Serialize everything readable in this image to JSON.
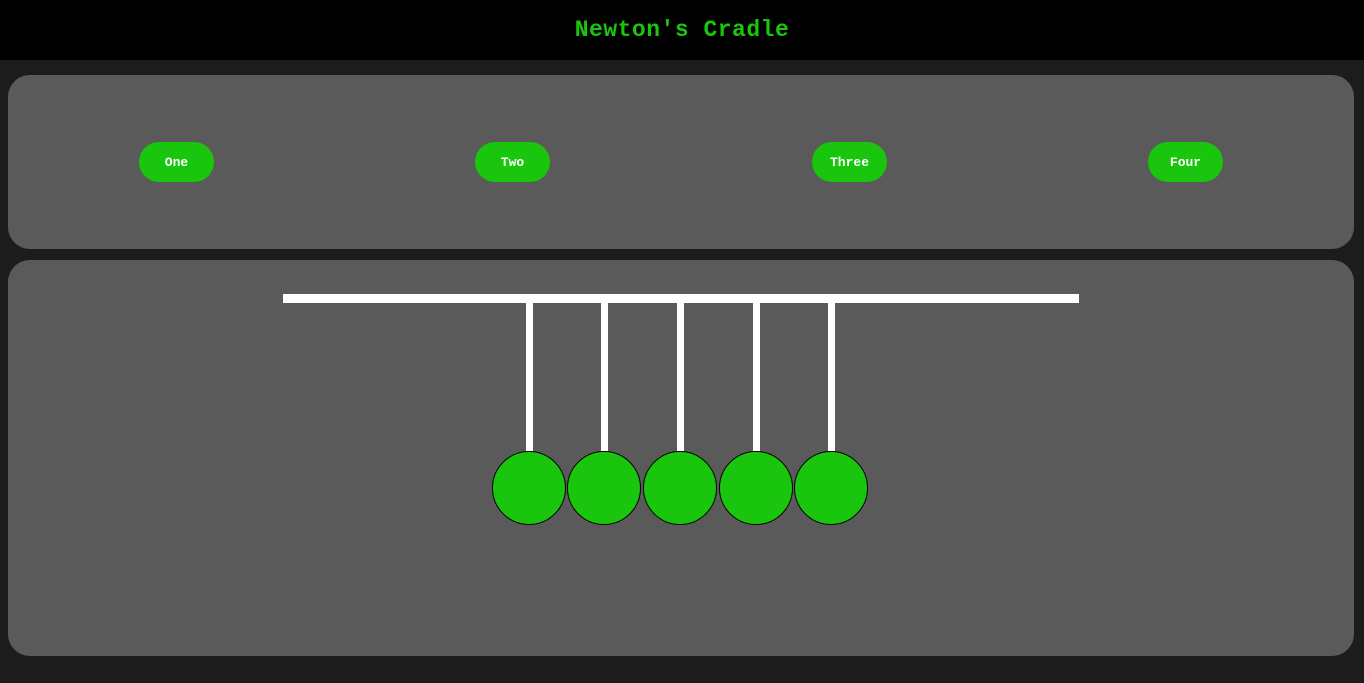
{
  "header": {
    "title": "Newton's Cradle"
  },
  "controls": {
    "buttons": [
      {
        "label": "One"
      },
      {
        "label": "Two"
      },
      {
        "label": "Three"
      },
      {
        "label": "Four"
      }
    ]
  },
  "cradle": {
    "ball_count": 5,
    "ball_color": "#19c60d",
    "string_color": "#ffffff",
    "bar_color": "#ffffff"
  },
  "colors": {
    "accent": "#19c60d",
    "header_bg": "#000000",
    "page_bg": "#1c1c1c",
    "panel_bg": "#5b5a5a"
  }
}
